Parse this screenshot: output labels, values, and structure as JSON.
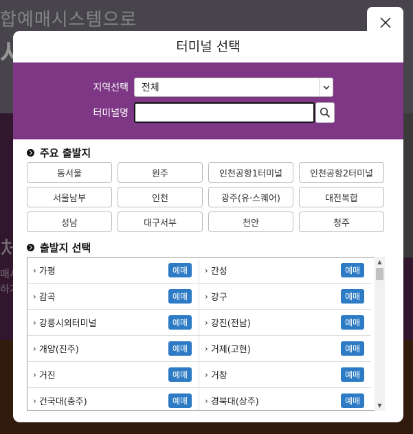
{
  "background": {
    "headline": "합예매시스템으로",
    "big_text": "사",
    "side_char": "체",
    "side_lines": [
      "매시",
      "하거"
    ]
  },
  "modal": {
    "title": "터미널 선택",
    "close_icon": "close-icon",
    "region": {
      "label": "지역선택",
      "value": "전체"
    },
    "terminal": {
      "label": "터미널명",
      "value": "",
      "placeholder": ""
    },
    "search_icon": "search-icon",
    "major_title": "주요 출발지",
    "major": [
      "동서울",
      "원주",
      "인천공항1터미널",
      "인천공항2터미널",
      "서울남부",
      "인천",
      "광주(유·스퀘어)",
      "대전복합",
      "성남",
      "대구서부",
      "천안",
      "청주"
    ],
    "departure_title": "출발지 선택",
    "reserve_label": "예매",
    "departures": [
      "가평",
      "간성",
      "감곡",
      "강구",
      "강릉시외터미널",
      "강진(전남)",
      "개양(진주)",
      "거제(고현)",
      "거진",
      "거창",
      "건국대(충주)",
      "경북대(상주)"
    ],
    "colors": {
      "panel": "#7d3785",
      "reserve": "#2d7bc4"
    }
  }
}
